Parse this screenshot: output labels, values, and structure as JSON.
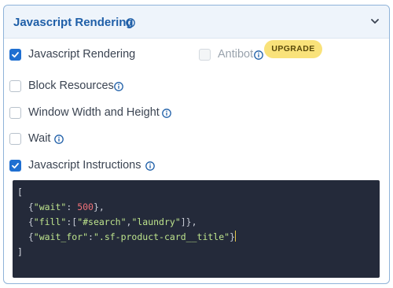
{
  "header": {
    "title": "Javascript Rendering",
    "info_icon": "info-icon",
    "collapse_icon": "chevron-down-icon"
  },
  "options": {
    "js_rendering": {
      "label": "Javascript Rendering",
      "checked": true
    },
    "antibot": {
      "label": "Antibot",
      "checked": false,
      "disabled": true,
      "badge": "UPGRADE"
    },
    "block_resources": {
      "label": "Block Resources",
      "checked": false
    },
    "window_size": {
      "label": "Window Width and Height",
      "checked": false
    },
    "wait": {
      "label": "Wait",
      "checked": false
    },
    "js_instructions": {
      "label": "Javascript Instructions",
      "checked": true
    }
  },
  "code": {
    "lines": [
      "[",
      "  {\"wait\": 500},",
      "  {\"fill\":[\"#search\",\"laundry\"]},",
      "  {\"wait_for\":\".sf-product-card__title\"}",
      "]"
    ]
  },
  "colors": {
    "accent": "#1f6fd1",
    "title": "#1f5fa8",
    "badge_bg": "#f9e27a",
    "code_bg": "#242a3a",
    "code_key": "#bde38c",
    "code_number": "#f07178"
  }
}
